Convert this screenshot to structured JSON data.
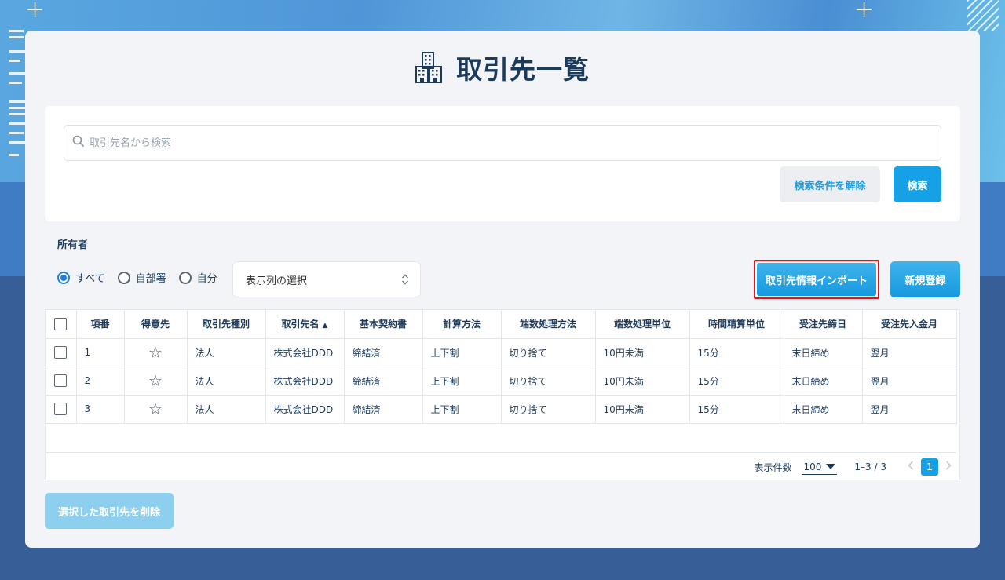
{
  "page": {
    "title": "取引先一覧"
  },
  "search": {
    "placeholder": "取引先名から検索",
    "clear_label": "検索条件を解除",
    "search_label": "検索"
  },
  "filters": {
    "owner_label": "所有者",
    "options": [
      {
        "label": "すべて",
        "checked": true
      },
      {
        "label": "自部署",
        "checked": false
      },
      {
        "label": "自分",
        "checked": false
      }
    ],
    "column_select_label": "表示列の選択"
  },
  "actions": {
    "import_label": "取引先情報インポート",
    "new_label": "新規登録",
    "delete_label": "選択した取引先を削除"
  },
  "table": {
    "headers": [
      "項番",
      "得意先",
      "取引先種別",
      "取引先名",
      "基本契約書",
      "計算方法",
      "端数処理方法",
      "端数処理単位",
      "時間精算単位",
      "受注先締日",
      "受注先入金月"
    ],
    "sort_indicator": "▲",
    "rows": [
      [
        "1",
        "法人",
        "株式会社DDD",
        "締結済",
        "上下割",
        "切り捨て",
        "10円未満",
        "15分",
        "末日締め",
        "翌月"
      ],
      [
        "2",
        "法人",
        "株式会社DDD",
        "締結済",
        "上下割",
        "切り捨て",
        "10円未満",
        "15分",
        "末日締め",
        "翌月"
      ],
      [
        "3",
        "法人",
        "株式会社DDD",
        "締結済",
        "上下割",
        "切り捨て",
        "10円未満",
        "15分",
        "末日締め",
        "翌月"
      ]
    ]
  },
  "pagination": {
    "per_page_label": "表示件数",
    "per_page_value": "100",
    "range": "1–3 / 3",
    "current_page": "1"
  },
  "colors": {
    "accent": "#16a1e6",
    "title": "#1b3a5c",
    "highlight_border": "#e0121a"
  }
}
